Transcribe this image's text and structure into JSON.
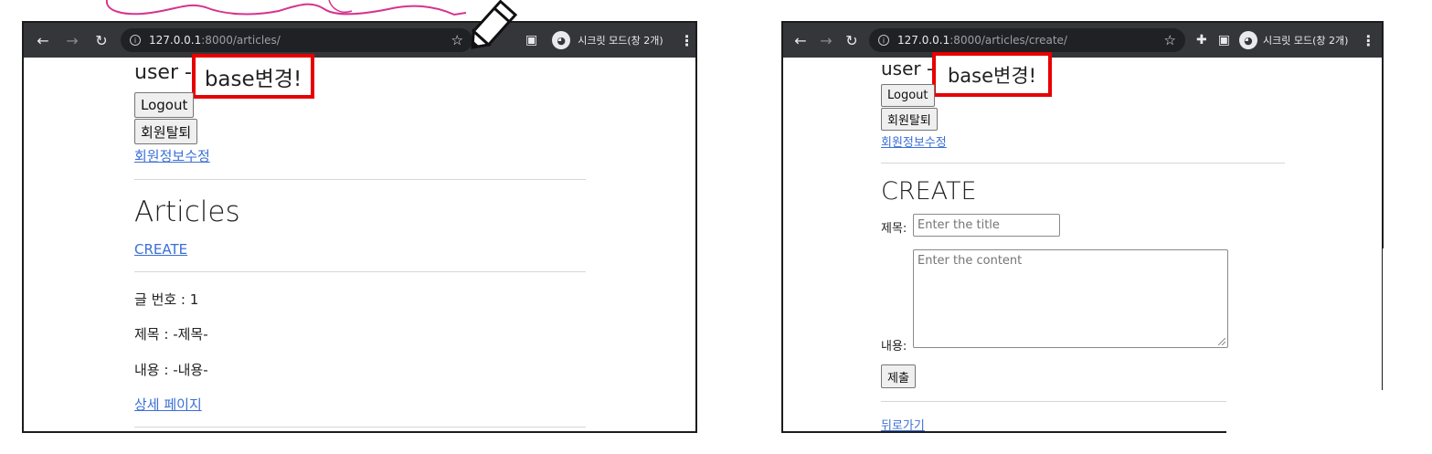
{
  "left_window": {
    "url_host": "127.0.0.1",
    "url_rest": ":8000/articles/",
    "incognito_label": "시크릿 모드(창 2개)",
    "page": {
      "user_name": "user",
      "dash": "-",
      "highlight_text": "base변경!",
      "logout_label": "Logout",
      "withdraw_label": "회원탈퇴",
      "edit_profile_link": "회원정보수정",
      "heading": "Articles",
      "create_link": "CREATE",
      "article": {
        "number_line": "글 번호 : 1",
        "title_line": "제목 : -제목-",
        "content_line": "내용 : -내용-",
        "detail_link": "상세 페이지"
      }
    }
  },
  "right_window": {
    "url_host": "127.0.0.1",
    "url_rest": ":8000/articles/create/",
    "incognito_label": "시크릿 모드(창 2개)",
    "page": {
      "user_name": "user",
      "dash": "-",
      "highlight_text": "base변경!",
      "logout_label": "Logout",
      "withdraw_label": "회원탈퇴",
      "edit_profile_link": "회원정보수정",
      "heading": "CREATE",
      "title_label": "제목:",
      "title_placeholder": "Enter the title",
      "content_label": "내용:",
      "content_placeholder": "Enter the content",
      "submit_label": "제출",
      "back_link": "뒤로가기"
    }
  },
  "colors": {
    "toolbar": "#35363a",
    "highlight_border": "#e60000",
    "link": "#3b6fd6",
    "doodle": "#d6338f"
  },
  "icons": {
    "back": "arrow-left",
    "forward": "arrow-right",
    "reload": "reload",
    "info": "info-circle",
    "bookmark": "star",
    "extensions": "puzzle",
    "tab_search": "window",
    "incognito": "incognito",
    "menu": "vertical-dots"
  }
}
